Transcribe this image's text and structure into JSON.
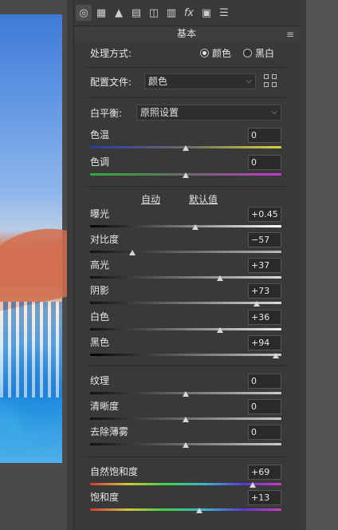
{
  "panel": {
    "section_title": "基本",
    "treatment": {
      "label": "处理方式:",
      "options": [
        "颜色",
        "黑白"
      ],
      "selected": "颜色"
    },
    "profile": {
      "label": "配置文件:",
      "value": "颜色"
    },
    "white_balance": {
      "label": "白平衡:",
      "value": "原照设置"
    },
    "auto_label": "自动",
    "default_label": "默认值",
    "sliders": [
      {
        "name": "色温",
        "value": "0",
        "level": 0.5
      },
      {
        "name": "色调",
        "value": "0",
        "level": 0.5
      },
      {
        "name": "曝光",
        "value": "+0.45",
        "level": 0.55
      },
      {
        "name": "对比度",
        "value": "−57",
        "level": 0.22
      },
      {
        "name": "高光",
        "value": "+37",
        "level": 0.68
      },
      {
        "name": "阴影",
        "value": "+73",
        "level": 0.87
      },
      {
        "name": "白色",
        "value": "+36",
        "level": 0.68
      },
      {
        "name": "黑色",
        "value": "+94",
        "level": 0.97
      },
      {
        "name": "纹理",
        "value": "0",
        "level": 0.5
      },
      {
        "name": "清晰度",
        "value": "0",
        "level": 0.5
      },
      {
        "name": "去除薄雾",
        "value": "0",
        "level": 0.5
      },
      {
        "name": "自然饱和度",
        "value": "+69",
        "level": 0.85
      },
      {
        "name": "饱和度",
        "value": "+13",
        "level": 0.57
      }
    ]
  },
  "tabs": [
    "basic-icon",
    "tone-curve-icon",
    "detail-icon",
    "hsl-icon",
    "split-toning-icon",
    "lens-icon",
    "fx-icon",
    "calibration-icon",
    "presets-icon"
  ],
  "tab_glyphs": [
    "◎",
    "▦",
    "▲",
    "▤",
    "◫",
    "▥",
    "fx",
    "▣",
    "☰"
  ],
  "menu_glyph": "≡",
  "select_arrow": "⌵"
}
